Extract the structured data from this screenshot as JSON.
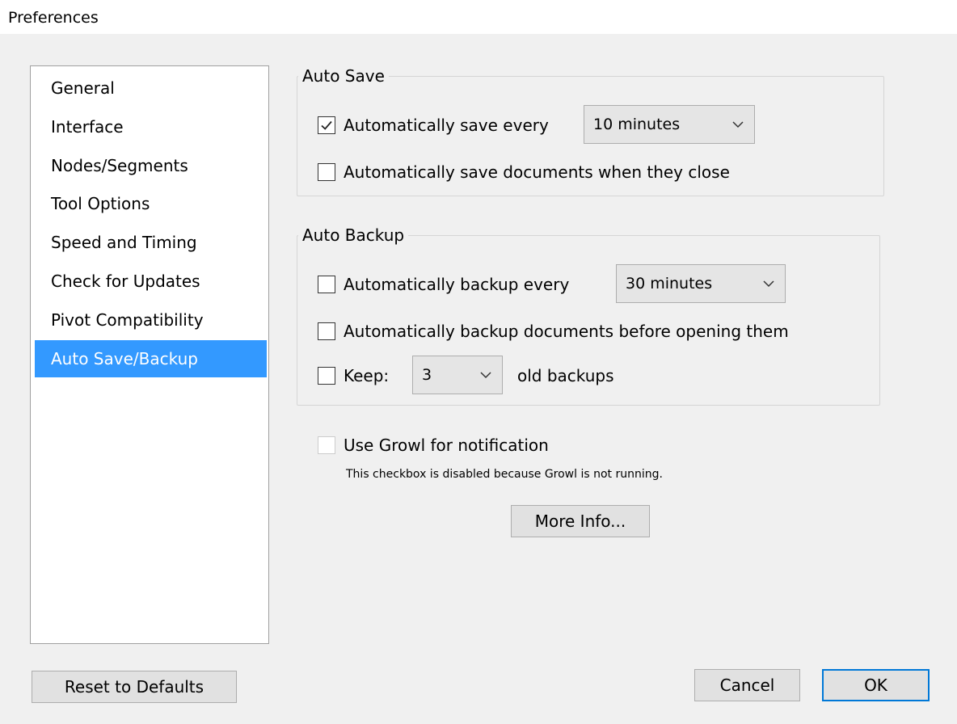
{
  "window": {
    "title": "Preferences"
  },
  "sidebar": {
    "items": [
      {
        "label": "General"
      },
      {
        "label": "Interface"
      },
      {
        "label": "Nodes/Segments"
      },
      {
        "label": "Tool Options"
      },
      {
        "label": "Speed and Timing"
      },
      {
        "label": "Check for Updates"
      },
      {
        "label": "Pivot Compatibility"
      },
      {
        "label": "Auto Save/Backup"
      }
    ],
    "selected": "Auto Save/Backup"
  },
  "auto_save": {
    "group_label": "Auto Save",
    "save_every": {
      "label": "Automatically save every",
      "checked": true,
      "value": "10 minutes"
    },
    "save_on_close": {
      "label": "Automatically save documents when they close",
      "checked": false
    }
  },
  "auto_backup": {
    "group_label": "Auto Backup",
    "backup_every": {
      "label": "Automatically backup every",
      "checked": false,
      "value": "30 minutes"
    },
    "backup_before_open": {
      "label": "Automatically backup documents before opening them",
      "checked": false
    },
    "keep": {
      "label": "Keep:",
      "checked": false,
      "value": "3",
      "suffix": "old backups"
    }
  },
  "growl": {
    "label": "Use Growl for notification",
    "enabled": false,
    "note": "This checkbox is disabled because Growl is not running.",
    "more_info_label": "More Info..."
  },
  "footer": {
    "reset_label": "Reset to Defaults",
    "cancel_label": "Cancel",
    "ok_label": "OK"
  },
  "colors": {
    "selection": "#3399ff",
    "default_button_border": "#0078d7"
  }
}
